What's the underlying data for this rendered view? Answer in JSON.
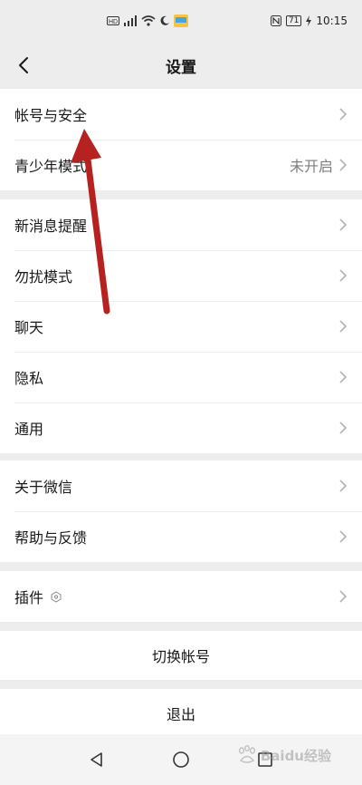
{
  "status_bar": {
    "left_icons": [
      "hd-icon",
      "signal-icon",
      "wifi-icon",
      "moon-icon",
      "app-icon"
    ],
    "battery": "71",
    "time": "10:15"
  },
  "nav": {
    "title": "设置"
  },
  "groups": {
    "account": [
      {
        "label": "帐号与安全",
        "value": ""
      },
      {
        "label": "青少年模式",
        "value": "未开启"
      }
    ],
    "notifications": [
      {
        "label": "新消息提醒"
      },
      {
        "label": "勿扰模式"
      },
      {
        "label": "聊天"
      },
      {
        "label": "隐私"
      },
      {
        "label": "通用"
      }
    ],
    "about": [
      {
        "label": "关于微信"
      },
      {
        "label": "帮助与反馈"
      }
    ],
    "plugins": [
      {
        "label": "插件"
      }
    ]
  },
  "actions": {
    "switch_account": "切换帐号",
    "logout": "退出"
  },
  "colors": {
    "background": "#ededed",
    "annotation_arrow": "#b5221f"
  },
  "watermark": "Baidu经验"
}
